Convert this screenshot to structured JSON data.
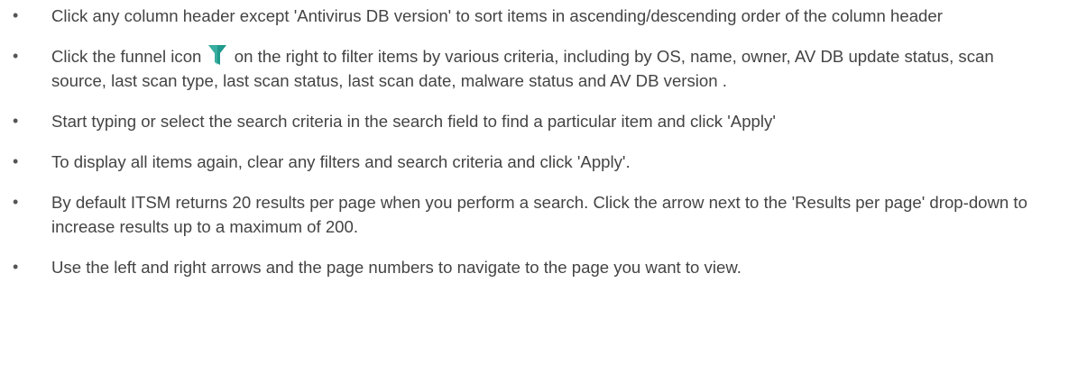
{
  "items": [
    {
      "text": "Click any column header except 'Antivirus DB version' to sort items in ascending/descending order of the column header"
    },
    {
      "text_before": "Click the funnel icon",
      "icon": "funnel-icon",
      "icon_color": "#1f9a8c",
      "text_after": " on the right to filter items by various criteria, including by OS, name, owner, AV DB update status, scan source, last scan type, last scan status, last scan date, malware status and AV DB version ."
    },
    {
      "text": "Start typing or select the search criteria in the search field to find a particular item and click 'Apply'"
    },
    {
      "text": "To display all items again, clear any filters and search criteria and click 'Apply'."
    },
    {
      "text": "By default ITSM returns 20 results per page when you perform a search. Click the arrow next to the 'Results per page' drop-down to increase results up to a maximum of 200."
    },
    {
      "text": "Use the left and right arrows and the page numbers to navigate to the page you want to view."
    }
  ],
  "bullet_char": "•"
}
